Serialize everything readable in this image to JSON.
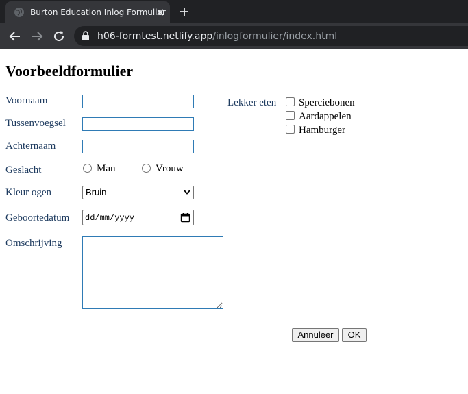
{
  "browser": {
    "tab_title": "Burton Education Inlog Formulier",
    "url_host": "h06-formtest.netlify.app",
    "url_path": "/inlogformulier/index.html"
  },
  "page": {
    "heading": "Voorbeeldformulier",
    "fields": {
      "voornaam": {
        "label": "Voornaam",
        "value": ""
      },
      "tussenvoegsel": {
        "label": "Tussenvoegsel",
        "value": ""
      },
      "achternaam": {
        "label": "Achternaam",
        "value": ""
      },
      "geslacht": {
        "label": "Geslacht",
        "options": [
          "Man",
          "Vrouw"
        ]
      },
      "kleur_ogen": {
        "label": "Kleur ogen",
        "selected": "Bruin"
      },
      "geboortedatum": {
        "label": "Geboortedatum",
        "placeholder": "dd/mm/yyyy"
      },
      "omschrijving": {
        "label": "Omschrijving",
        "value": ""
      }
    },
    "lekker_eten": {
      "label": "Lekker eten",
      "options": [
        "Sperciebonen",
        "Aardappelen",
        "Hamburger"
      ]
    },
    "buttons": {
      "cancel": "Annuleer",
      "ok": "OK"
    }
  }
}
